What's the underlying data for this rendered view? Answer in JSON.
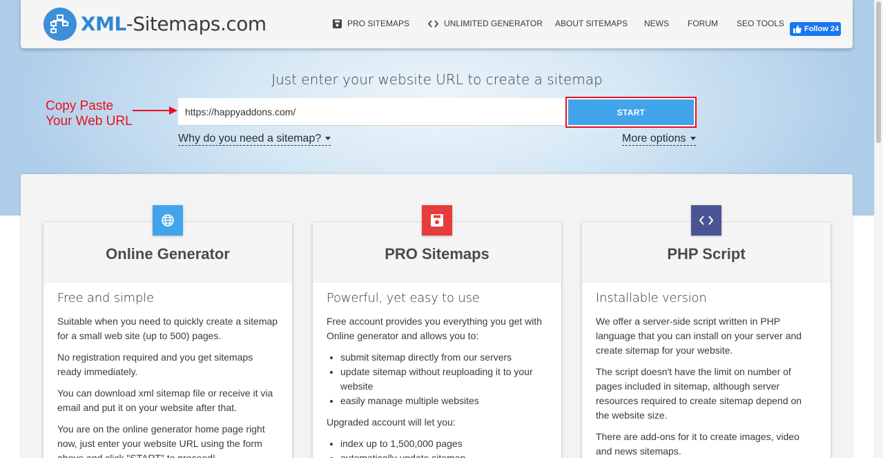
{
  "header": {
    "logo_xml": "XML",
    "logo_rest": "-Sitemaps.com",
    "nav": [
      {
        "label": "PRO SITEMAPS",
        "icon": "save-icon"
      },
      {
        "label": "UNLIMITED GENERATOR",
        "icon": "code-icon"
      },
      {
        "label": "ABOUT SITEMAPS"
      },
      {
        "label": "NEWS"
      },
      {
        "label": "FORUM"
      },
      {
        "label": "SEO TOOLS"
      }
    ],
    "fb_label": "Follow 24"
  },
  "hero": {
    "title": "Just enter your website URL to create a sitemap",
    "annotation_line1": "Copy Paste",
    "annotation_line2": "Your Web URL",
    "url_value": "https://happyaddons.com/",
    "start_label": "START",
    "why_link": "Why do you need a sitemap?",
    "more_link": "More options"
  },
  "cards": [
    {
      "title": "Online Generator",
      "icon": "globe-icon",
      "subtitle": "Free and simple",
      "paragraphs": [
        "Suitable when you need to quickly create a sitemap for a small web site (up to 500) pages.",
        "No registration required and you get sitemaps ready immediately.",
        "You can download xml sitemap file or receive it via email and put it on your website after that.",
        "You are on the online generator home page right now, just enter your website URL using the form above and click \"START\" to proceed!"
      ]
    },
    {
      "title": "PRO Sitemaps",
      "icon": "save-icon",
      "subtitle": "Powerful, yet easy to use",
      "intro": "Free account provides you everything you get with Online generator and allows you to:",
      "list1": [
        "submit sitemap directly from our servers",
        "update sitemap without reuploading it to your website",
        "easily manage multiple websites"
      ],
      "mid": "Upgraded account will let you:",
      "list2": [
        "index up to 1,500,000 pages",
        "automatically update sitemap"
      ]
    },
    {
      "title": "PHP Script",
      "icon": "code-icon",
      "subtitle": "Installable version",
      "paragraphs": [
        "We offer a server-side script written in PHP language that you can install on your server and create sitemap for your website.",
        "The script doesn't have the limit on number of pages included in sitemap, although server resources required to create sitemap depend on the website size.",
        "There are add-ons for it to create images, video and news sitemaps."
      ]
    }
  ],
  "colors": {
    "accent_blue": "#42a4eb",
    "annotation_red": "#e8101e",
    "icon_globe": "#42a4eb",
    "icon_pro": "#e83b3b",
    "icon_php": "#4a5493"
  }
}
